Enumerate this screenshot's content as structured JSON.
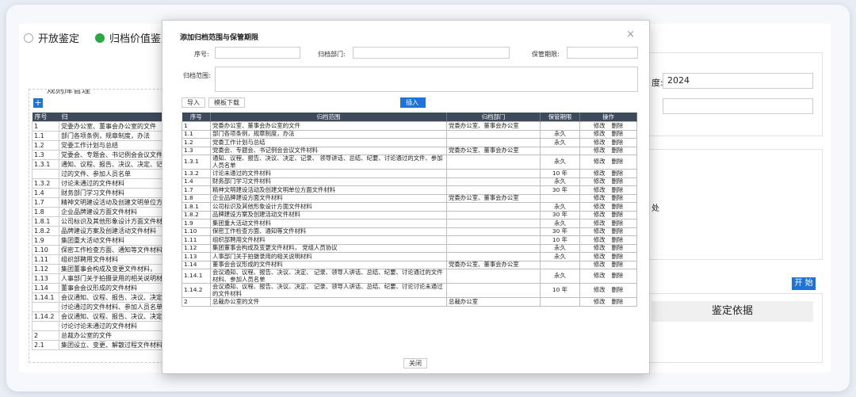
{
  "background": {
    "radio_open": "开放鉴定",
    "radio_archive": "归档价值鉴定",
    "rule_section_title": "规则库管理",
    "add_button": "+",
    "rule_table_headers": [
      "序号",
      "归"
    ],
    "rule_rows": [
      [
        "1",
        "党委办公室、董事会办公室的文件"
      ],
      [
        "1.1",
        "部门各项条例，规章制度，办法"
      ],
      [
        "1.2",
        "党委工作计划与总结"
      ],
      [
        "1.3",
        "党委会、专题会、书记例会会议文件"
      ],
      [
        "1.3.1",
        "通知、议程、报告、决议、决定、记录"
      ],
      [
        "",
        "过的文件、参加人员名单"
      ],
      [
        "1.3.2",
        "讨论未通过的文件材料"
      ],
      [
        "1.4",
        "财务部门学习文件材料"
      ],
      [
        "1.7",
        "精神文明建设活动及创建文明单位方面"
      ],
      [
        "1.8",
        "企业品牌建设方面文件材料"
      ],
      [
        "1.8.1",
        "公司标识及其他形象设计方面文件材料"
      ],
      [
        "1.8.2",
        "品牌建设方案及创建活动文件材料"
      ],
      [
        "1.9",
        "集团重大活动文件材料"
      ],
      [
        "1.10",
        "保密工作检查方面、通知等文件材料"
      ],
      [
        "1.11",
        "组织部聘用文件材料"
      ],
      [
        "1.12",
        "集团董事会构成及变更文件材料，"
      ],
      [
        "1.13",
        "人事部门关于拍摄录用的相关说明材料"
      ],
      [
        "1.14",
        "董事会会议形成的文件材料"
      ],
      [
        "1.14.1",
        "会议通知、议程、报告、决议、决定"
      ],
      [
        "",
        "讨论通过的文件材料、参加人员名单"
      ],
      [
        "1.14.2",
        "会议通知、议程、报告、决议、决定"
      ],
      [
        "",
        "讨论讨论未通过的文件材料"
      ],
      [
        "2",
        "总裁办公室的文件"
      ],
      [
        "2.1",
        "集团设立、变更、解散过程文件材料"
      ]
    ],
    "year_label": "度:",
    "year_value": "2024",
    "right_hint": "处",
    "start_button": "开 始",
    "basis_header": "鉴定依据"
  },
  "dialog": {
    "title": "添加归档范围与保管期限",
    "close_icon": "×",
    "seq_label": "序号:",
    "dept_label": "归档部门:",
    "period_label": "保管期限:",
    "scope_label": "归档范围:",
    "import_button": "导入",
    "template_button": "模板下载",
    "insert_button": "插入",
    "close_button": "关闭",
    "headers": [
      "序号",
      "归档范围",
      "归档部门",
      "保管期限",
      "操作"
    ],
    "edit_label": "修改",
    "delete_label": "删除",
    "rows": [
      {
        "seq": "1",
        "scope": "党委办公室、董事会办公室的文件",
        "dept": "党委办公室、董事会办公室",
        "period": ""
      },
      {
        "seq": "1.1",
        "scope": "部门各项条例，规章制度，办法",
        "dept": "",
        "period": "永久"
      },
      {
        "seq": "1.2",
        "scope": "党委工作计划与总结",
        "dept": "",
        "period": "永久"
      },
      {
        "seq": "1.3",
        "scope": "党委会、专题会、书记例会会议文件材料",
        "dept": "党委办公室、董事会办公室",
        "period": ""
      },
      {
        "seq": "1.3.1",
        "scope": "通知、议程、报告、决议、决定、记录、 领导讲话、总结、纪要、讨论通过的文件、参加人员名单",
        "dept": "",
        "period": "永久"
      },
      {
        "seq": "1.3.2",
        "scope": "讨论未通过的文件材料",
        "dept": "",
        "period": "10 年"
      },
      {
        "seq": "1.4",
        "scope": "财务部门学习文件材料",
        "dept": "",
        "period": "永久"
      },
      {
        "seq": "1.7",
        "scope": "精神文明建设活动及创建文明单位方面文件材料",
        "dept": "",
        "period": "30 年"
      },
      {
        "seq": "1.8",
        "scope": "企业品牌建设方面文件材料",
        "dept": "党委办公室、董事会办公室",
        "period": ""
      },
      {
        "seq": "1.8.1",
        "scope": "公司标识及其他形象设计方面文件材料",
        "dept": "",
        "period": "永久"
      },
      {
        "seq": "1.8.2",
        "scope": "品牌建设方案及创建活动文件材料",
        "dept": "",
        "period": "30 年"
      },
      {
        "seq": "1.9",
        "scope": "集团重大活动文件材料",
        "dept": "",
        "period": "永久"
      },
      {
        "seq": "1.10",
        "scope": "保密工作检查方面、通知等文件材料",
        "dept": "",
        "period": "30 年"
      },
      {
        "seq": "1.11",
        "scope": "组织部聘用文件材料",
        "dept": "",
        "period": "10 年"
      },
      {
        "seq": "1.12",
        "scope": "集团董事会构成及变更文件材料， 党组人员协议",
        "dept": "",
        "period": "永久"
      },
      {
        "seq": "1.13",
        "scope": "人事部门关于拍摄录用的相关说明材料",
        "dept": "",
        "period": "永久"
      },
      {
        "seq": "1.14",
        "scope": "董事会会议形成的文件材料",
        "dept": "党委办公室、董事会办公室",
        "period": ""
      },
      {
        "seq": "1.14.1",
        "scope": "会议通知、议程、报告、决议、决定、 记录、领导人讲话、总结、纪要、讨论通过的文件材料、参加人员名单",
        "dept": "",
        "period": "永久"
      },
      {
        "seq": "1.14.2",
        "scope": "会议通知、议程、报告、决议、决定、 记录、领导人讲话、总结、纪要、讨论讨论未通过的文件材料",
        "dept": "",
        "period": "10 年"
      },
      {
        "seq": "2",
        "scope": "总裁办公室的文件",
        "dept": "总裁办公室",
        "period": ""
      }
    ]
  }
}
